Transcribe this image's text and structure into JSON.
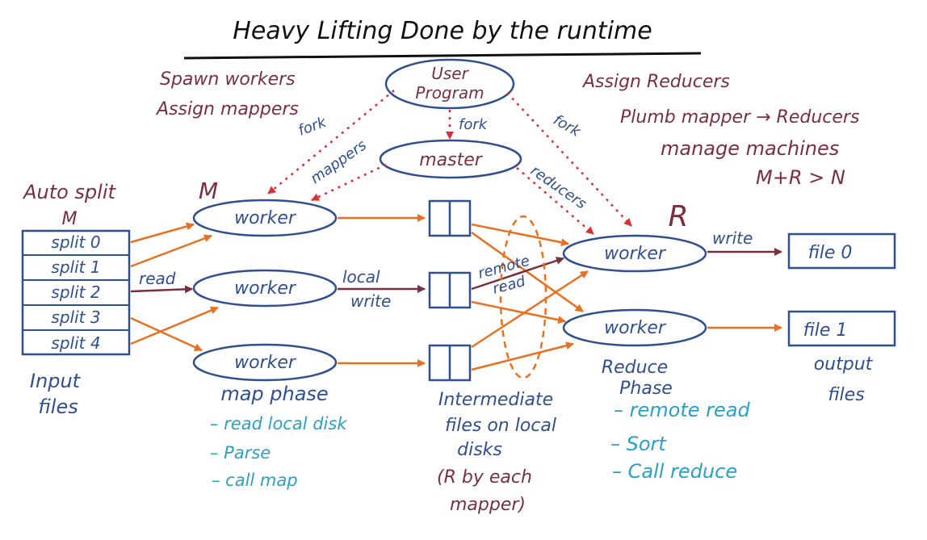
{
  "title": "Heavy Lifting Done by the runtime",
  "notes_left": [
    "Spawn workers",
    "Assign mappers"
  ],
  "notes_right": [
    "Assign Reducers",
    "Plumb mapper → Reducers",
    "manage machines",
    "M+R > N"
  ],
  "user_program": [
    "User",
    "Program"
  ],
  "master": "master",
  "edge_labels": {
    "fork_left": "fork",
    "fork_mid": "fork",
    "fork_right": "fork",
    "mappers": "mappers",
    "reducers": "reducers",
    "read": "read",
    "local_write": [
      "local",
      "write"
    ],
    "remote_read": [
      "remote",
      "read"
    ],
    "write": "write"
  },
  "auto_split": [
    "Auto split",
    "M"
  ],
  "splits": [
    "split 0",
    "split 1",
    "split 2",
    "split 3",
    "split 4"
  ],
  "input_files": [
    "Input",
    "files"
  ],
  "m_label": "M",
  "r_label": "R",
  "map_workers": [
    "worker",
    "worker",
    "worker"
  ],
  "reduce_workers": [
    "worker",
    "worker"
  ],
  "map_phase": {
    "title": "map phase",
    "steps": [
      "– read local disk",
      "– Parse",
      "– call map"
    ]
  },
  "intermediate": {
    "lines": [
      "Intermediate",
      "files on local",
      "disks"
    ],
    "note": [
      "(R by each",
      "mapper)"
    ]
  },
  "reduce_phase": {
    "title": [
      "Reduce",
      "Phase"
    ],
    "steps": [
      "– remote read",
      "– Sort",
      "– Call reduce"
    ]
  },
  "output_files_boxes": [
    "file 0",
    "file 1"
  ],
  "output_files_label": [
    "output",
    "files"
  ],
  "colors": {
    "maroon": "#7a2f3f",
    "blue": "#2f4f8f",
    "orange": "#e8701e",
    "red_dotted": "#d9303a",
    "teal": "#2aa0c8"
  }
}
